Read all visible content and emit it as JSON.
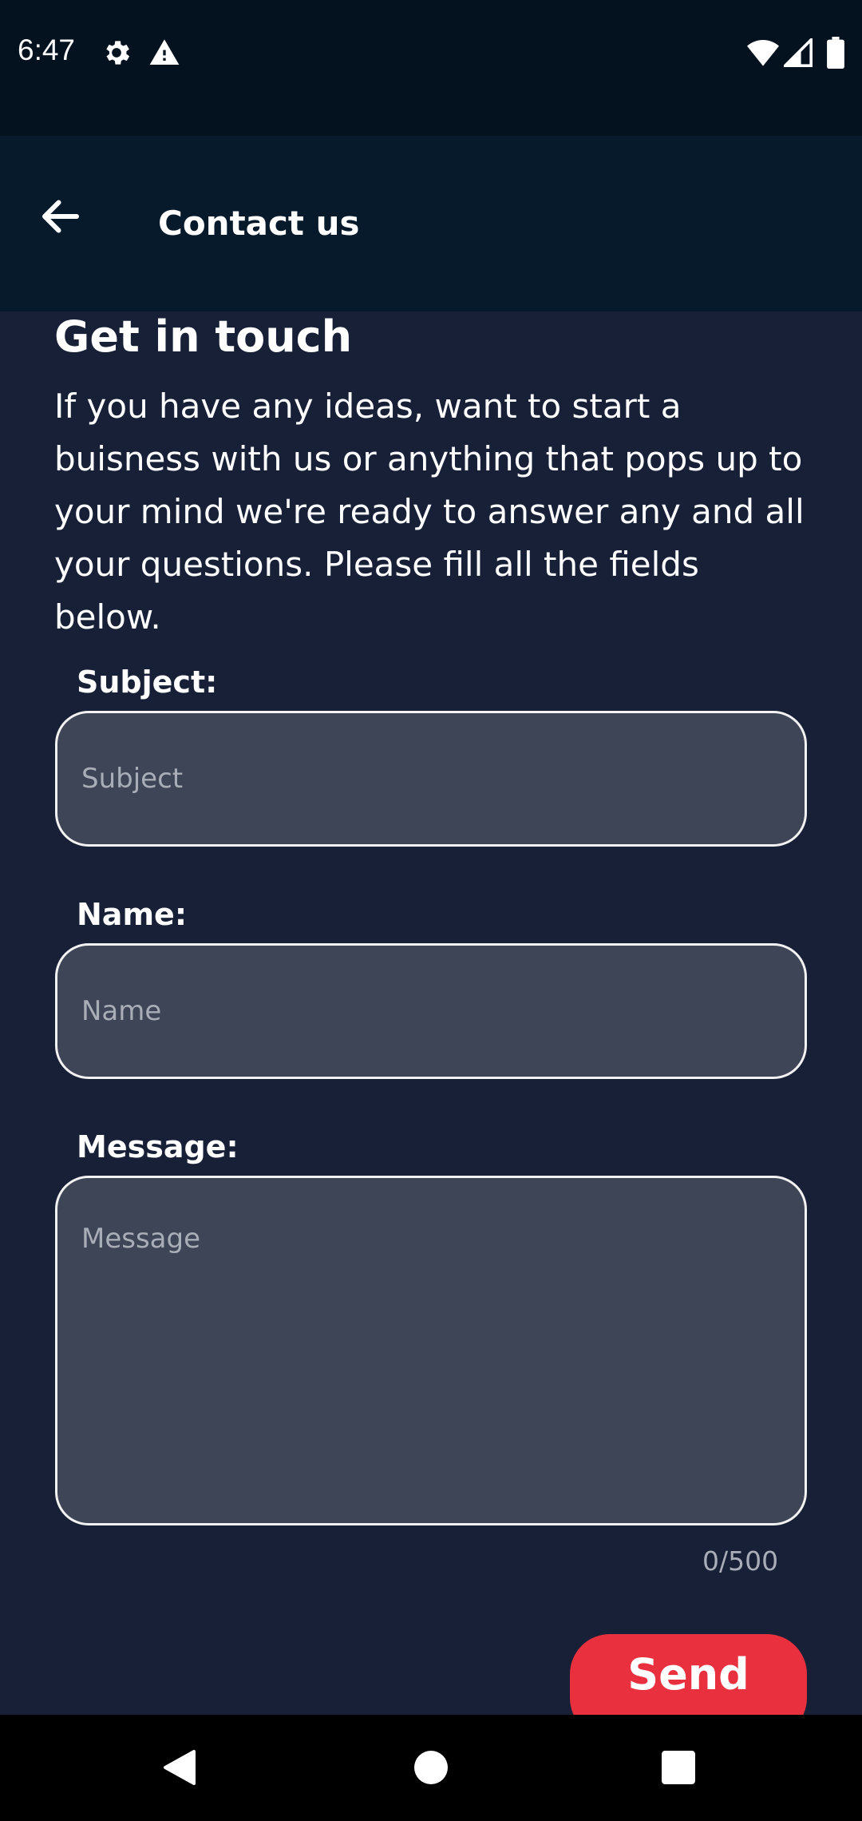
{
  "status_bar": {
    "time": "6:47",
    "left_icons": [
      "settings-icon",
      "warning-icon"
    ],
    "right_icons": [
      "wifi-icon",
      "signal-icon",
      "battery-icon"
    ]
  },
  "app_bar": {
    "back_icon": "arrow-back-icon",
    "title": "Contact us"
  },
  "content": {
    "heading": "Get in touch",
    "intro": "If you have any ideas, want to start a buisness with us or anything that pops up to your mind we're ready to answer any and all your questions. Please fill all the fields below.",
    "subject": {
      "label": "Subject:",
      "placeholder": "Subject",
      "value": ""
    },
    "name": {
      "label": "Name:",
      "placeholder": "Name",
      "value": ""
    },
    "message": {
      "label": "Message:",
      "placeholder": "Message",
      "value": ""
    },
    "counter": "0/500",
    "send_label": "Send"
  },
  "colors": {
    "background": "#172036",
    "app_bar": "#071a2c",
    "status_bar": "#04121f",
    "field_fill": "#3d4556",
    "accent": "#e8303e"
  },
  "nav_bar": {
    "icons": [
      "back-triangle-icon",
      "home-circle-icon",
      "recents-square-icon"
    ]
  }
}
